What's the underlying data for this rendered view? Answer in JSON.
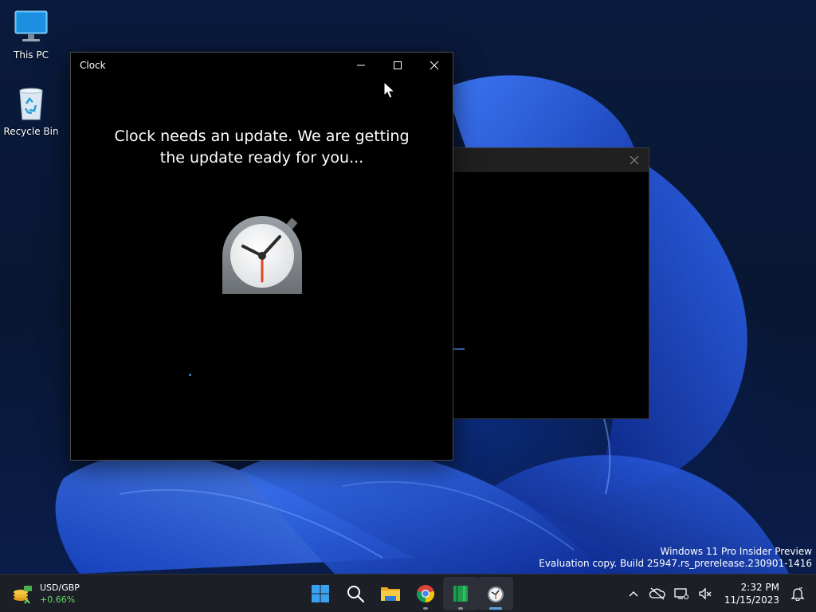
{
  "desktop": {
    "icons": [
      {
        "label": "This PC",
        "icon": "monitor-icon"
      },
      {
        "label": "Recycle Bin",
        "icon": "recycle-bin-icon"
      }
    ],
    "watermark": {
      "line1": "Windows 11 Pro Insider Preview",
      "line2": "Evaluation copy. Build 25947.rs_prerelease.230901-1416"
    }
  },
  "clock_window": {
    "title": "Clock",
    "message_line1": "Clock needs an update. We are getting",
    "message_line2": "the update ready for you...",
    "icon": "stopwatch-icon",
    "caption_buttons": [
      "minimize-icon",
      "maximize-icon",
      "close-icon"
    ]
  },
  "back_window": {
    "caption_buttons": [
      "close-icon"
    ]
  },
  "taskbar": {
    "widget": {
      "title": "USD/GBP",
      "change": "+0.66%",
      "icon": "currency-icon",
      "change_color": "#6cd96c"
    },
    "apps": [
      {
        "name": "start",
        "icon": "windows-logo-icon"
      },
      {
        "name": "search",
        "icon": "search-icon"
      },
      {
        "name": "file-explorer",
        "icon": "folder-icon"
      },
      {
        "name": "chrome",
        "icon": "chrome-icon"
      },
      {
        "name": "green-app",
        "icon": "green-book-icon"
      },
      {
        "name": "clock",
        "icon": "clock-icon"
      }
    ],
    "tray": {
      "time": "2:32 PM",
      "date": "11/15/2023",
      "icons": [
        "chevron-up-icon",
        "cloud-off-icon",
        "network-icon",
        "volume-mute-icon",
        "notification-icon"
      ]
    }
  },
  "colors": {
    "accent": "#5aa0e8",
    "taskbar": "#1c1f26",
    "window": "#000000"
  }
}
